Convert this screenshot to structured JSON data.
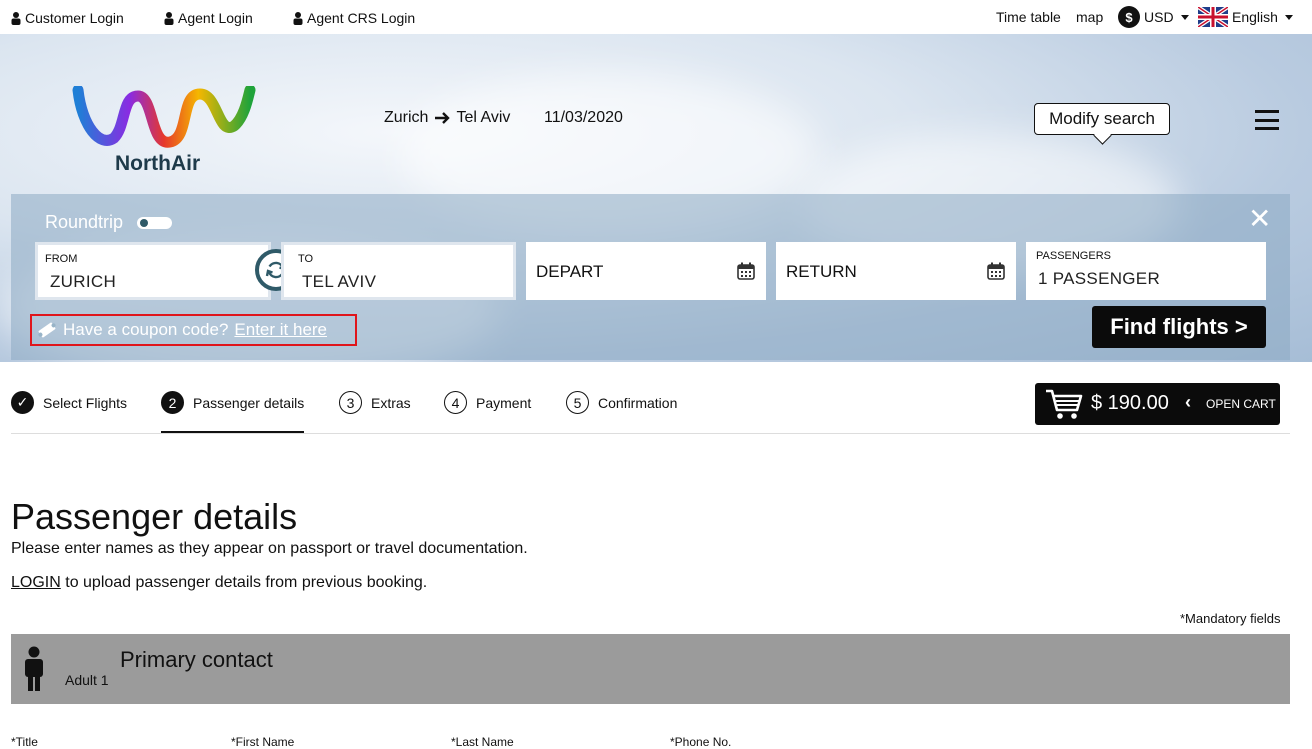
{
  "topbar": {
    "customer_login": "Customer Login",
    "agent_login": "Agent Login",
    "agent_crs_login": "Agent CRS Login",
    "timetable": "Time table",
    "map": "map",
    "currency_symbol": "$",
    "currency": "USD",
    "language": "English"
  },
  "header": {
    "brand": "NorthAir",
    "origin": "Zurich",
    "destination": "Tel Aviv",
    "date": "11/03/2020",
    "modify_search": "Modify search"
  },
  "search": {
    "roundtrip_label": "Roundtrip",
    "from_label": "FROM",
    "from_value": "ZURICH",
    "to_label": "TO",
    "to_value": "TEL AVIV",
    "depart_label": "DEPART",
    "return_label": "RETURN",
    "passengers_label": "PASSENGERS",
    "passengers_value": "1 PASSENGER",
    "coupon_text": "Have a coupon code?",
    "coupon_link": "Enter it here",
    "find_flights": "Find flights >"
  },
  "steps": [
    {
      "num": "✓",
      "label": "Select Flights"
    },
    {
      "num": "2",
      "label": "Passenger details"
    },
    {
      "num": "3",
      "label": "Extras"
    },
    {
      "num": "4",
      "label": "Payment"
    },
    {
      "num": "5",
      "label": "Confirmation"
    }
  ],
  "cart": {
    "price": "$ 190.00",
    "open": "OPEN CART"
  },
  "main": {
    "title": "Passenger details",
    "instructions": "Please enter names as they appear on passport or travel documentation.",
    "login_link": "LOGIN",
    "login_text": " to upload passenger details from previous booking.",
    "mandatory": "*Mandatory fields",
    "contact_title": "Primary contact",
    "contact_sub": "Adult 1",
    "field_labels": [
      "*Title",
      "*First Name",
      "*Last Name",
      "*Phone No."
    ]
  },
  "colors": {
    "accent": "#2f5a68",
    "highlight_border": "#e0151b",
    "dark_button": "#0b0b0b",
    "contact_bar": "#9b9b9b"
  }
}
